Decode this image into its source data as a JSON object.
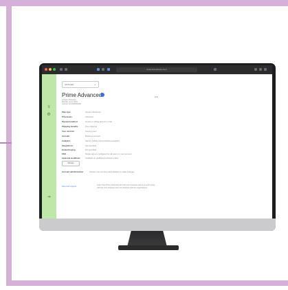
{
  "colors": {
    "frame": "#d5b1d8",
    "sidebar": "#bfe7a8",
    "accent": "#3b6fd4"
  },
  "browser": {
    "traffic_lights": [
      "#ff5f57",
      "#febc2e",
      "#28c840"
    ],
    "url": "amazonbusiness.com"
  },
  "sidebar": {
    "icons": [
      "filter-icon",
      "settings-icon",
      "logout-icon"
    ]
  },
  "content": {
    "dropdown_value": "All Details",
    "title": "Prime Advanced",
    "subtitle_lines": [
      "Amazon Business",
      "Member since 2023",
      "Account ID 0000000000"
    ],
    "edit_label": "Edit",
    "details": [
      {
        "label": "Plan type",
        "value": "Amazon Business"
      },
      {
        "label": "Price/seats",
        "value": "Unlimited"
      },
      {
        "label": "Payment method",
        "value": "Invoice or billing account on file"
      },
      {
        "label": "Shipping benefits",
        "value": "Free shipping"
      },
      {
        "label": "Your next bill",
        "value": "Coming soon"
      },
      {
        "label": "Account",
        "value": "Business account"
      },
      {
        "label": "Analytics",
        "value": "Spend visibility and purchasing analytics"
      },
      {
        "label": "Integrations",
        "value": "Not specified"
      },
      {
        "label": "Guided buying",
        "value": "Not specified"
      },
      {
        "label": "SSO",
        "value": "Single sign-on configured for all users on your account"
      },
      {
        "label": "Approval workflows",
        "value": "Available on qualifying business orders"
      }
    ],
    "button_label": "Manage",
    "extra_row": {
      "label": "Account administration",
      "value": "Contact your account administrator to make changes"
    },
    "link_text": "Help and support",
    "note_lines": [
      "Learn how Prime Advanced can help your business save time and money",
      "with fast, free shipping and more features built for organizations."
    ]
  }
}
